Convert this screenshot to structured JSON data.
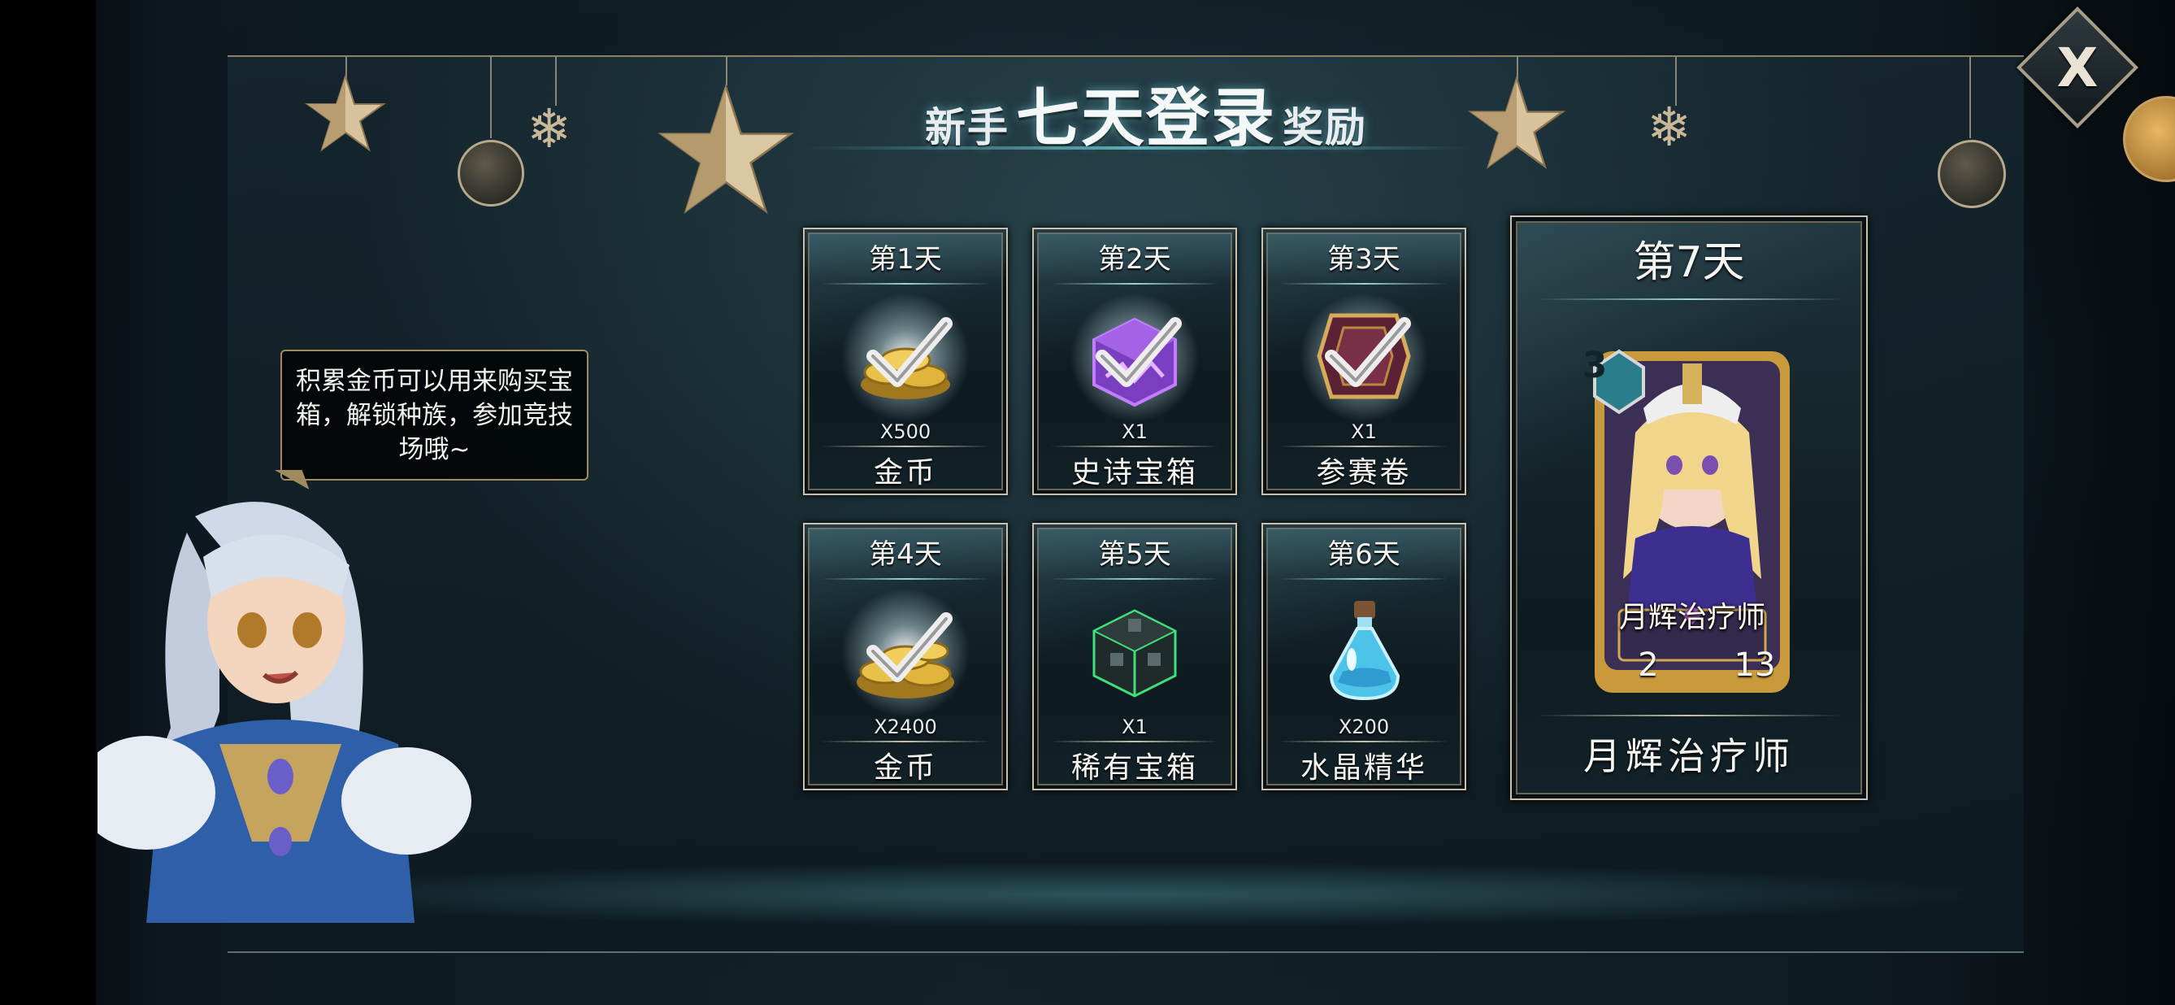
{
  "title": {
    "prefix": "新手",
    "main": "七天登录",
    "suffix": "奖励"
  },
  "close_button": {
    "label": "X"
  },
  "tip": {
    "text": "积累金币可以用来购买宝箱，解锁种族，参加竞技场哦~"
  },
  "days": [
    {
      "day": "第1天",
      "qty": "X500",
      "name": "金币",
      "icon": "gold-coins-icon"
    },
    {
      "day": "第2天",
      "qty": "X1",
      "name": "史诗宝箱",
      "icon": "epic-chest-icon"
    },
    {
      "day": "第3天",
      "qty": "X1",
      "name": "参赛卷",
      "icon": "entry-ticket-icon"
    },
    {
      "day": "第4天",
      "qty": "X2400",
      "name": "金币",
      "icon": "gold-coins-icon"
    },
    {
      "day": "第5天",
      "qty": "X1",
      "name": "稀有宝箱",
      "icon": "rare-chest-icon"
    },
    {
      "day": "第6天",
      "qty": "X200",
      "name": "水晶精华",
      "icon": "crystal-essence-icon"
    }
  ],
  "day7": {
    "day": "第7天",
    "name": "月辉治疗师",
    "hero": {
      "card_name": "月辉治疗师",
      "level": "3",
      "attack": "2",
      "health": "13"
    }
  },
  "colors": {
    "frame": "#c8c0ab",
    "accent_teal": "#6ec8d2",
    "gold": "#c9a46a",
    "claimed_check": "#e6e6e6"
  }
}
